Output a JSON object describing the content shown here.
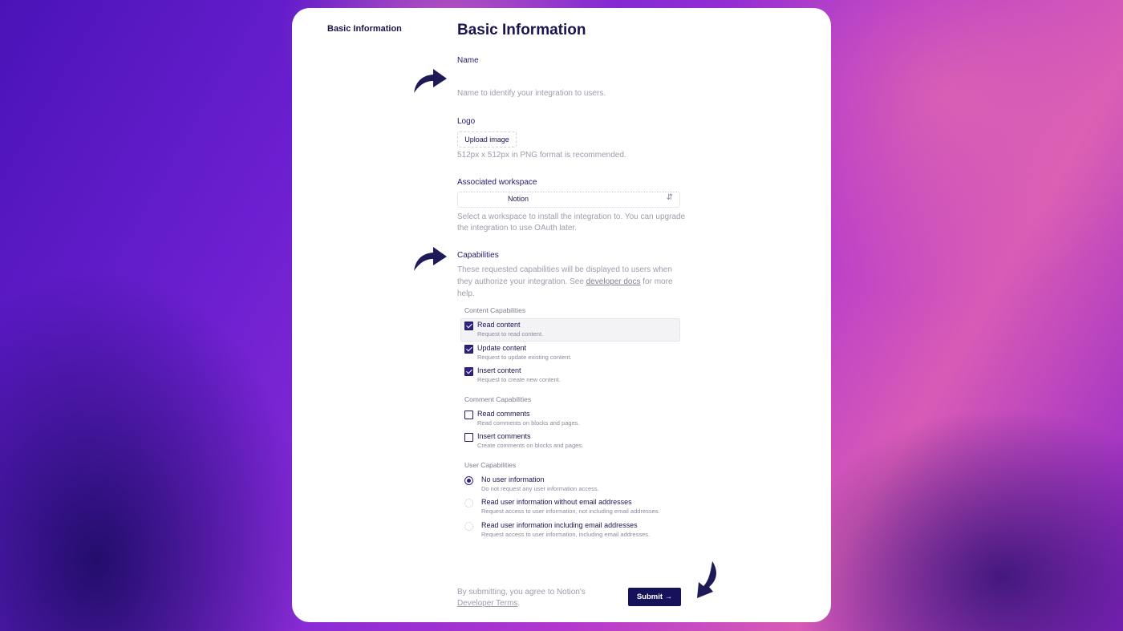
{
  "sidebar": {
    "title": "Basic Information"
  },
  "page": {
    "title": "Basic Information"
  },
  "name_field": {
    "label": "Name",
    "help": "Name to identify your integration to users."
  },
  "logo": {
    "label": "Logo",
    "upload_label": "Upload image",
    "help": "512px x 512px in PNG format is recommended."
  },
  "workspace": {
    "label": "Associated workspace",
    "selected": "Notion",
    "help_line1": "Select a workspace to install the integration to. You can upgrade",
    "help_line2": "the integration to use OAuth later."
  },
  "capabilities": {
    "label": "Capabilities",
    "help_line1": "These requested capabilities will be displayed to users when",
    "help_line2_pre": "they authorize your integration. See",
    "help_link": "developer docs",
    "help_line2_post": "for more",
    "help_line3": "help.",
    "content": {
      "heading": "Content Capabilities",
      "items": [
        {
          "title": "Read content",
          "desc": "Request to read content.",
          "checked": true
        },
        {
          "title": "Update content",
          "desc": "Request to update existing content.",
          "checked": true
        },
        {
          "title": "Insert content",
          "desc": "Request to create new content.",
          "checked": true
        }
      ]
    },
    "comment": {
      "heading": "Comment Capabilities",
      "items": [
        {
          "title": "Read comments",
          "desc": "Read comments on blocks and pages.",
          "checked": false
        },
        {
          "title": "Insert comments",
          "desc": "Create comments on blocks and pages.",
          "checked": false
        }
      ]
    },
    "user": {
      "heading": "User Capabilities",
      "items": [
        {
          "title": "No user information",
          "desc": "Do not request any user information access.",
          "selected": true
        },
        {
          "title": "Read user information without email addresses",
          "desc": "Request access to user information, not including email addresses.",
          "selected": false
        },
        {
          "title": "Read user information including email addresses",
          "desc": "Request access to user information, including email addresses.",
          "selected": false
        }
      ]
    }
  },
  "footer": {
    "terms_line1": "By submitting, you agree to Notion's",
    "terms_link": "Developer Terms",
    "terms_end": ".",
    "submit_label": "Submit →"
  },
  "colors": {
    "accent": "#14125a",
    "text": "#1a1550",
    "muted": "#9d9cab"
  },
  "icons": [
    "curved-arrow-icon",
    "chevron-updown-icon",
    "checkbox-icon",
    "radio-icon"
  ]
}
